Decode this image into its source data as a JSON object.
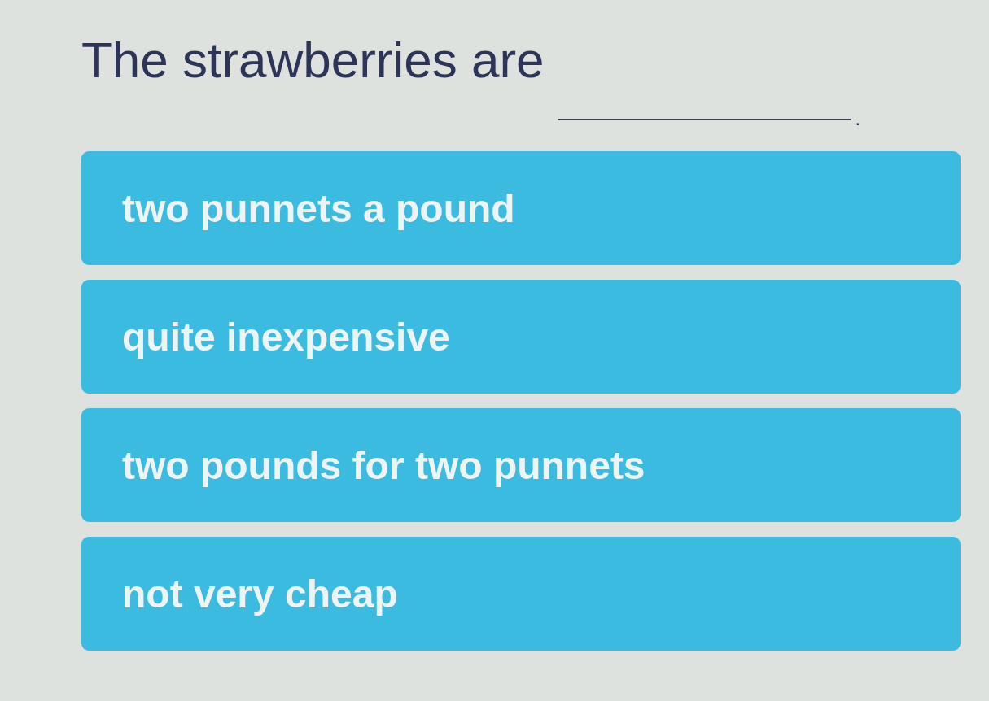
{
  "question": {
    "text": "The strawberries are",
    "end": "."
  },
  "options": [
    {
      "label": "two punnets a pound",
      "selected": false
    },
    {
      "label": "quite inexpensive",
      "selected": false
    },
    {
      "label": "two pounds for two punnets",
      "selected": false
    },
    {
      "label": "not very cheap",
      "selected": false
    }
  ]
}
